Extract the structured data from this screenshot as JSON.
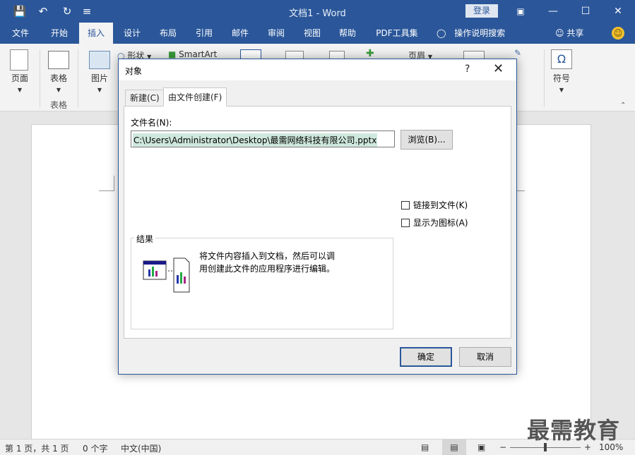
{
  "window": {
    "title": "文档1  -  Word",
    "login": "登录",
    "minimize_glyph": "—",
    "restore_glyph": "☐",
    "close_glyph": "✕"
  },
  "quick_access": {
    "save_icon": "save-icon",
    "undo_icon": "undo-icon",
    "redo_icon": "redo-icon",
    "customize_icon": "customize-icon"
  },
  "ribbon": {
    "tabs": [
      "文件",
      "开始",
      "插入",
      "设计",
      "布局",
      "引用",
      "邮件",
      "审阅",
      "视图",
      "帮助",
      "PDF工具集"
    ],
    "active_tab": "插入",
    "tell_me": "操作说明搜索",
    "share": "共享",
    "groups": {
      "pages_label": "页面",
      "table_label": "表格",
      "table_group_label": "表格",
      "pictures_label": "图片",
      "shapes_label": "形状",
      "smartart_label": "SmartArt",
      "header_label": "页眉",
      "symbol_label": "符号"
    }
  },
  "dialog": {
    "title": "对象",
    "help": "?",
    "close": "✕",
    "tabs": {
      "new": "新建(C)",
      "from_file": "由文件创建(F)"
    },
    "filename_label": "文件名(N):",
    "filename_value": "C:\\Users\\Administrator\\Desktop\\最需网络科技有限公司.pptx",
    "browse": "浏览(B)...",
    "link_to_file": "链接到文件(K)",
    "display_as_icon": "显示为图标(A)",
    "result_label": "结果",
    "result_text": "将文件内容插入到文档，然后可以调用创建此文件的应用程序进行编辑。",
    "ok": "确定",
    "cancel": "取消"
  },
  "statusbar": {
    "page": "第 1 页，共 1 页",
    "words": "0 个字",
    "language": "中文(中国)",
    "zoom": "100%",
    "zoom_level": 1.0
  },
  "watermark": "最需教育",
  "colors": {
    "accent": "#2b579a",
    "selection": "#cfe8dd"
  }
}
